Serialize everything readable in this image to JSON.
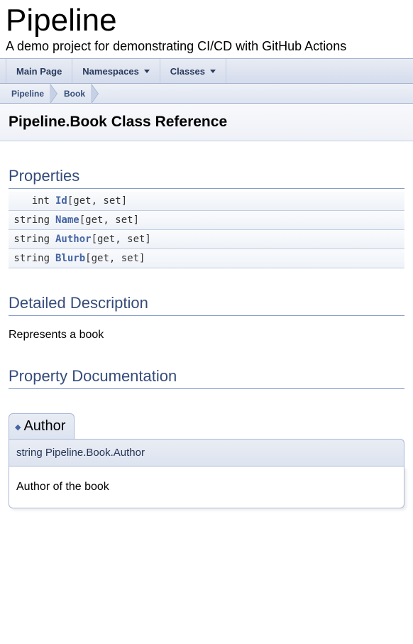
{
  "header": {
    "project_name": "Pipeline",
    "project_brief": "A demo project for demonstrating CI/CD with GitHub Actions"
  },
  "tabs": [
    {
      "label": "Main Page",
      "dropdown": false
    },
    {
      "label": "Namespaces",
      "dropdown": true
    },
    {
      "label": "Classes",
      "dropdown": true
    }
  ],
  "navpath": [
    {
      "label": "Pipeline"
    },
    {
      "label": "Book"
    }
  ],
  "page_title": "Pipeline.Book Class Reference",
  "sections": {
    "properties_header": "Properties",
    "detailed_header": "Detailed Description",
    "propdoc_header": "Property Documentation"
  },
  "properties": [
    {
      "type": "int",
      "name": "Id",
      "accessor": "[get, set]"
    },
    {
      "type": "string",
      "name": "Name",
      "accessor": "[get, set]"
    },
    {
      "type": "string",
      "name": "Author",
      "accessor": "[get, set]"
    },
    {
      "type": "string",
      "name": "Blurb",
      "accessor": "[get, set]"
    }
  ],
  "detailed_description": "Represents a book",
  "property_doc": {
    "tab_title": "Author",
    "signature": "string Pipeline.Book.Author",
    "description": "Author of the book"
  }
}
